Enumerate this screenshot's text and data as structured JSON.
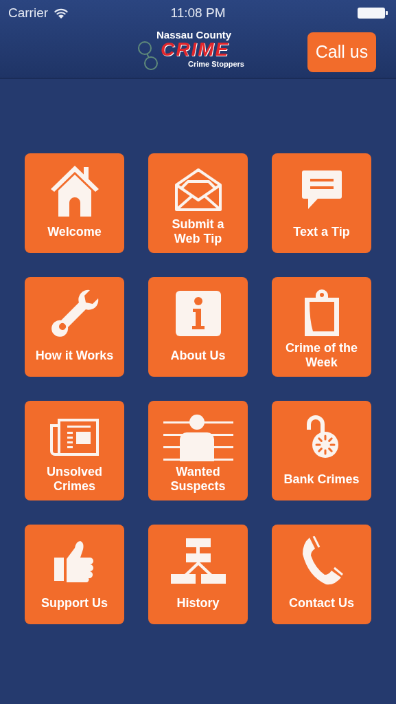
{
  "status_bar": {
    "carrier": "Carrier",
    "time": "11:08 PM"
  },
  "header": {
    "logo": {
      "top": "Nassau County",
      "main": "CRIME",
      "bottom": "Crime Stoppers"
    },
    "call_button": "Call us"
  },
  "tiles": [
    {
      "kind": "house",
      "label": "Welcome"
    },
    {
      "kind": "envelope",
      "label": "Submit a Web Tip"
    },
    {
      "kind": "chat",
      "label": "Text a Tip"
    },
    {
      "kind": "wrench",
      "label": "How it Works"
    },
    {
      "kind": "info",
      "label": "About Us"
    },
    {
      "kind": "clipboard",
      "label": "Crime of the Week"
    },
    {
      "kind": "newspaper",
      "label": "Unsolved Crimes"
    },
    {
      "kind": "lineup",
      "label": "Wanted Suspects"
    },
    {
      "kind": "lock",
      "label": "Bank Crimes"
    },
    {
      "kind": "thumb",
      "label": "Support Us"
    },
    {
      "kind": "chart",
      "label": "History"
    },
    {
      "kind": "phone",
      "label": "Contact Us"
    }
  ]
}
